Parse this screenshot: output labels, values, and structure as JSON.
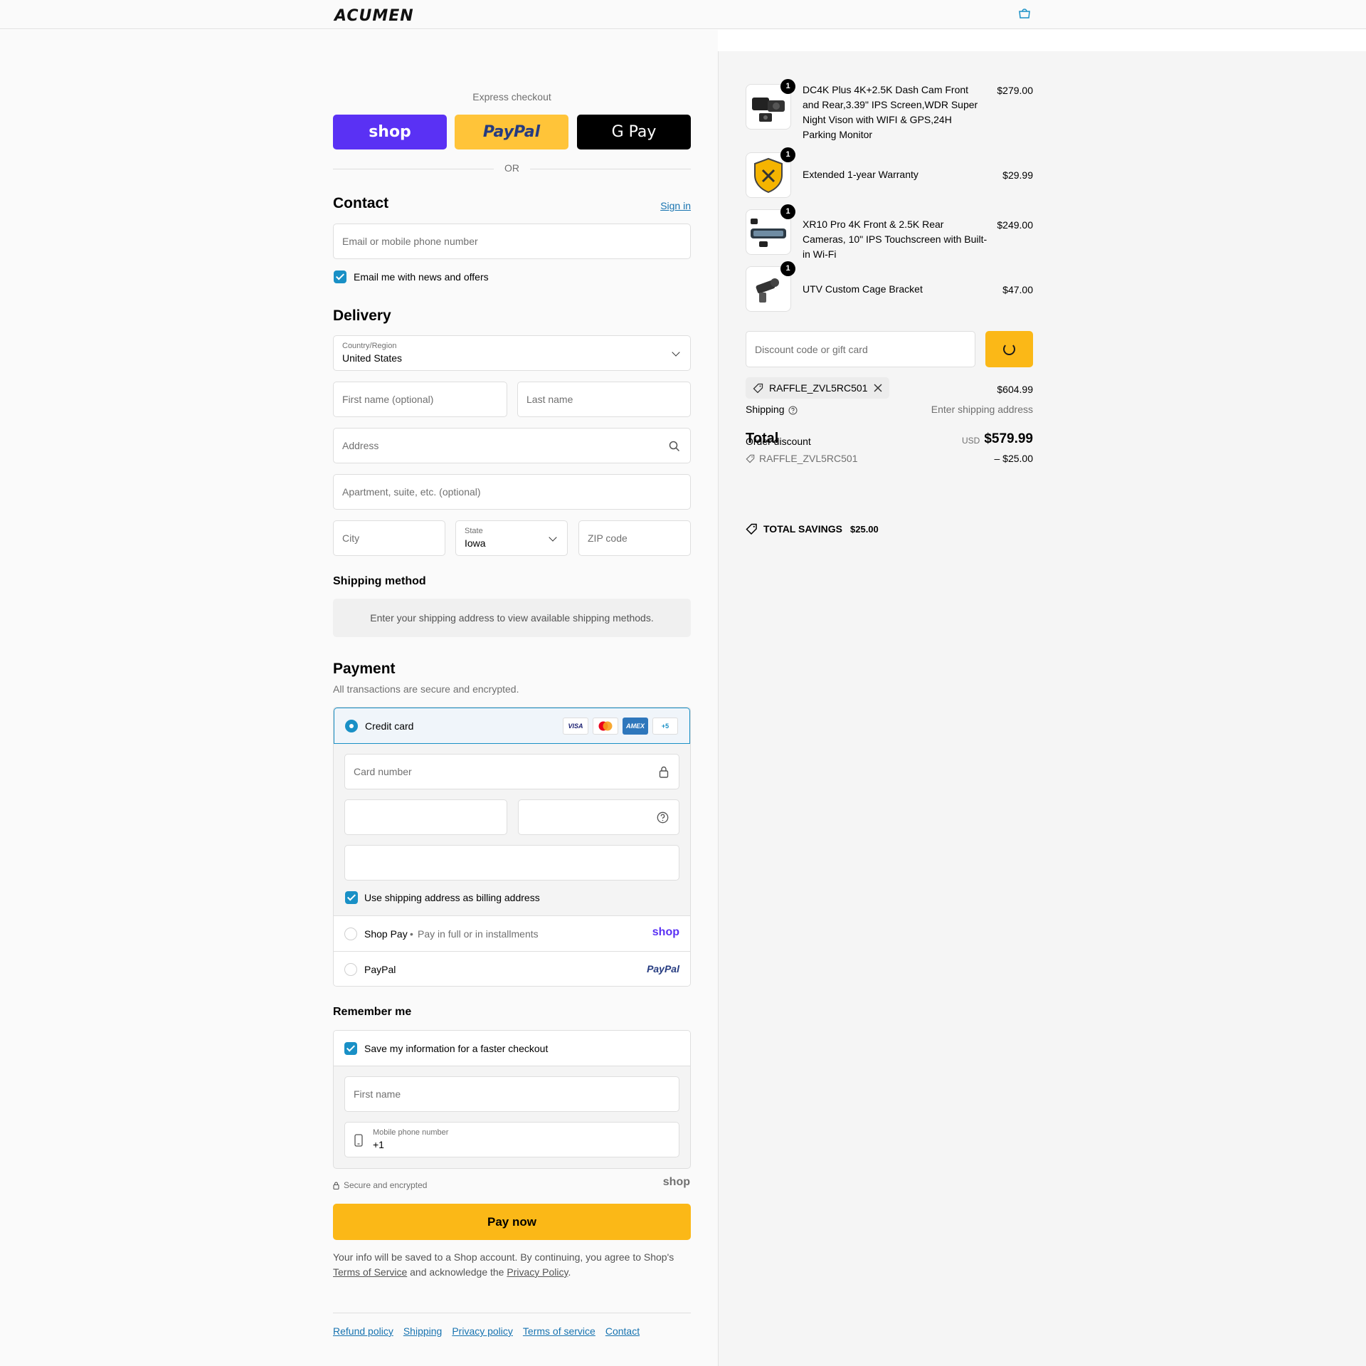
{
  "header": {
    "logo": "ACUMEN"
  },
  "express": {
    "label": "Express checkout",
    "shop_label": "shop",
    "paypal_label": "PayPal",
    "gpay_label": "G Pay",
    "or": "OR"
  },
  "contact": {
    "title": "Contact",
    "sign_in": "Sign in",
    "email_placeholder": "Email or mobile phone number",
    "newsletter_label": "Email me with news and offers"
  },
  "delivery": {
    "title": "Delivery",
    "country_label": "Country/Region",
    "country_value": "United States",
    "first_name_placeholder": "First name (optional)",
    "last_name_placeholder": "Last name",
    "address_placeholder": "Address",
    "apartment_placeholder": "Apartment, suite, etc. (optional)",
    "city_placeholder": "City",
    "state_label": "State",
    "state_value": "Iowa",
    "zip_placeholder": "ZIP code"
  },
  "shipping_method": {
    "title": "Shipping method",
    "info": "Enter your shipping address to view available shipping methods."
  },
  "payment": {
    "title": "Payment",
    "subtitle": "All transactions are secure and encrypted.",
    "credit_card_label": "Credit card",
    "card_logos": [
      "VISA",
      "MC",
      "AMEX",
      "+5"
    ],
    "card_number_placeholder": "Card number",
    "billing_label": "Use shipping address as billing address",
    "shop_pay_label": "Shop Pay",
    "shop_pay_desc": "Pay in full or in installments",
    "shop_pay_logo": "shop",
    "paypal_label": "PayPal",
    "paypal_logo": "PayPal"
  },
  "remember": {
    "title": "Remember me",
    "save_label": "Save my information for a faster checkout",
    "first_name_placeholder": "First name",
    "phone_label": "Mobile phone number",
    "phone_value": "+1"
  },
  "secure": {
    "text": "Secure and encrypted",
    "shop_logo": "shop"
  },
  "pay_now": "Pay now",
  "legal": {
    "text1": "Your info will be saved to a Shop account. By continuing, you agree to Shop's",
    "terms": "Terms of Service",
    "text2": "and acknowledge the",
    "privacy": "Privacy Policy",
    "period": "."
  },
  "footer": {
    "links": [
      "Refund policy",
      "Shipping",
      "Privacy policy",
      "Terms of service",
      "Contact"
    ]
  },
  "order": {
    "items": [
      {
        "name": "DC4K Plus 4K+2.5K Dash Cam Front and Rear,3.39\" IPS Screen,WDR Super Night Vison with WIFI & GPS,24H Parking Monitor",
        "price": "$279.00",
        "qty": "1"
      },
      {
        "name": "Extended 1-year Warranty",
        "price": "$29.99",
        "qty": "1"
      },
      {
        "name": "XR10 Pro 4K Front & 2.5K Rear Cameras, 10\" IPS Touchscreen with Built-in Wi-Fi",
        "price": "$249.00",
        "qty": "1"
      },
      {
        "name": "UTV Custom Cage Bracket",
        "price": "$47.00",
        "qty": "1"
      }
    ],
    "discount_placeholder": "Discount code or gift card",
    "code_chip": "RAFFLE_ZVL5RC501",
    "subtotal": "$604.99",
    "shipping_label": "Shipping",
    "shipping_value": "Enter shipping address",
    "total_label": "Total",
    "order_discount_label": "Order discount",
    "currency": "USD",
    "total_value": "$579.99",
    "discount_code": "RAFFLE_ZVL5RC501",
    "discount_value": "– $25.00",
    "savings_label": "TOTAL SAVINGS",
    "savings_value": "$25.00"
  },
  "colors": {
    "accent": "#1990c6",
    "pay_button": "#fbb817",
    "shop_purple": "#5a31f4"
  }
}
